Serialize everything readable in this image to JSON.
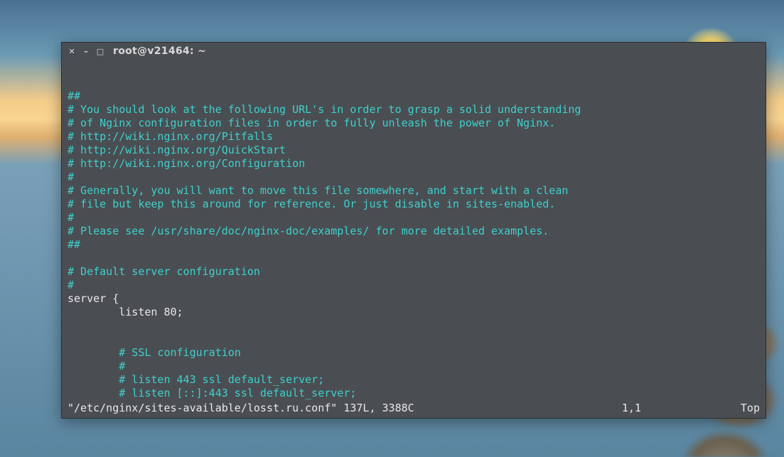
{
  "window": {
    "title": "root@v21464: ~"
  },
  "editor": {
    "lines": [
      {
        "cls": "comment",
        "text": "##"
      },
      {
        "cls": "comment",
        "text": "# You should look at the following URL's in order to grasp a solid understanding"
      },
      {
        "cls": "comment",
        "text": "# of Nginx configuration files in order to fully unleash the power of Nginx."
      },
      {
        "cls": "comment",
        "text": "# http://wiki.nginx.org/Pitfalls"
      },
      {
        "cls": "comment",
        "text": "# http://wiki.nginx.org/QuickStart"
      },
      {
        "cls": "comment",
        "text": "# http://wiki.nginx.org/Configuration"
      },
      {
        "cls": "comment",
        "text": "#"
      },
      {
        "cls": "comment",
        "text": "# Generally, you will want to move this file somewhere, and start with a clean"
      },
      {
        "cls": "comment",
        "text": "# file but keep this around for reference. Or just disable in sites-enabled."
      },
      {
        "cls": "comment",
        "text": "#"
      },
      {
        "cls": "comment",
        "text": "# Please see /usr/share/doc/nginx-doc/examples/ for more detailed examples."
      },
      {
        "cls": "comment",
        "text": "##"
      },
      {
        "cls": "code",
        "text": ""
      },
      {
        "cls": "comment",
        "text": "# Default server configuration"
      },
      {
        "cls": "comment",
        "text": "#"
      },
      {
        "cls": "code",
        "text": "server {"
      },
      {
        "cls": "code",
        "text": "        listen 80;"
      },
      {
        "cls": "code",
        "text": ""
      },
      {
        "cls": "code",
        "text": ""
      },
      {
        "cls": "comment",
        "text": "        # SSL configuration"
      },
      {
        "cls": "comment",
        "text": "        #"
      },
      {
        "cls": "comment",
        "text": "        # listen 443 ssl default_server;"
      },
      {
        "cls": "comment",
        "text": "        # listen [::]:443 ssl default_server;"
      }
    ],
    "status": {
      "file": "\"/etc/nginx/sites-available/losst.ru.conf\" 137L, 3388C",
      "position": "1,1",
      "scroll": "Top"
    }
  }
}
